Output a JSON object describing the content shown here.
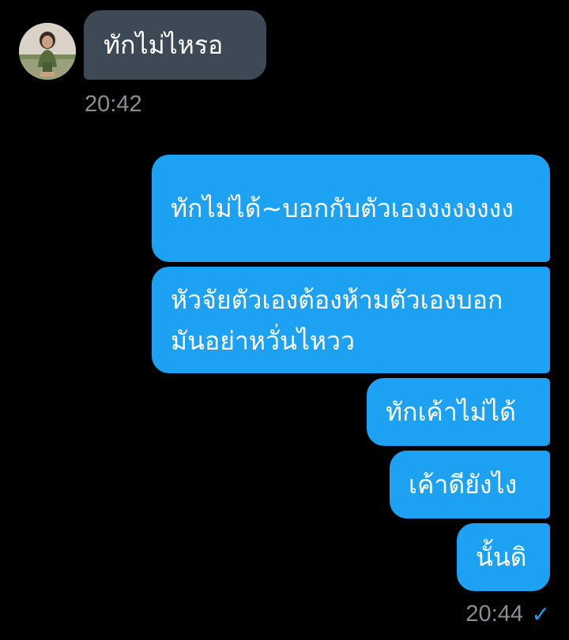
{
  "incoming": {
    "text": "ทักไม่ไหรอ",
    "time": "20:42"
  },
  "outgoing": {
    "messages": [
      "ทักไม่ได้~บอกกับตัวเองงงงงงงง",
      "หัวจัยตัวเองต้องห้ามตัวเองบอกมันอย่าหวั่นไหวว",
      "ทักเค้าไม่ได้",
      "เค้าดียังไง",
      "นั้นดิ"
    ],
    "time": "20:44",
    "read_receipt": "✓"
  },
  "icons": {
    "avatar": "contact-avatar",
    "read": "check-icon"
  },
  "colors": {
    "background": "#000000",
    "incoming_bubble": "#3d4a55",
    "outgoing_bubble": "#1da1f2",
    "timestamp": "#8a8d91",
    "read_check": "#1da1f2"
  }
}
